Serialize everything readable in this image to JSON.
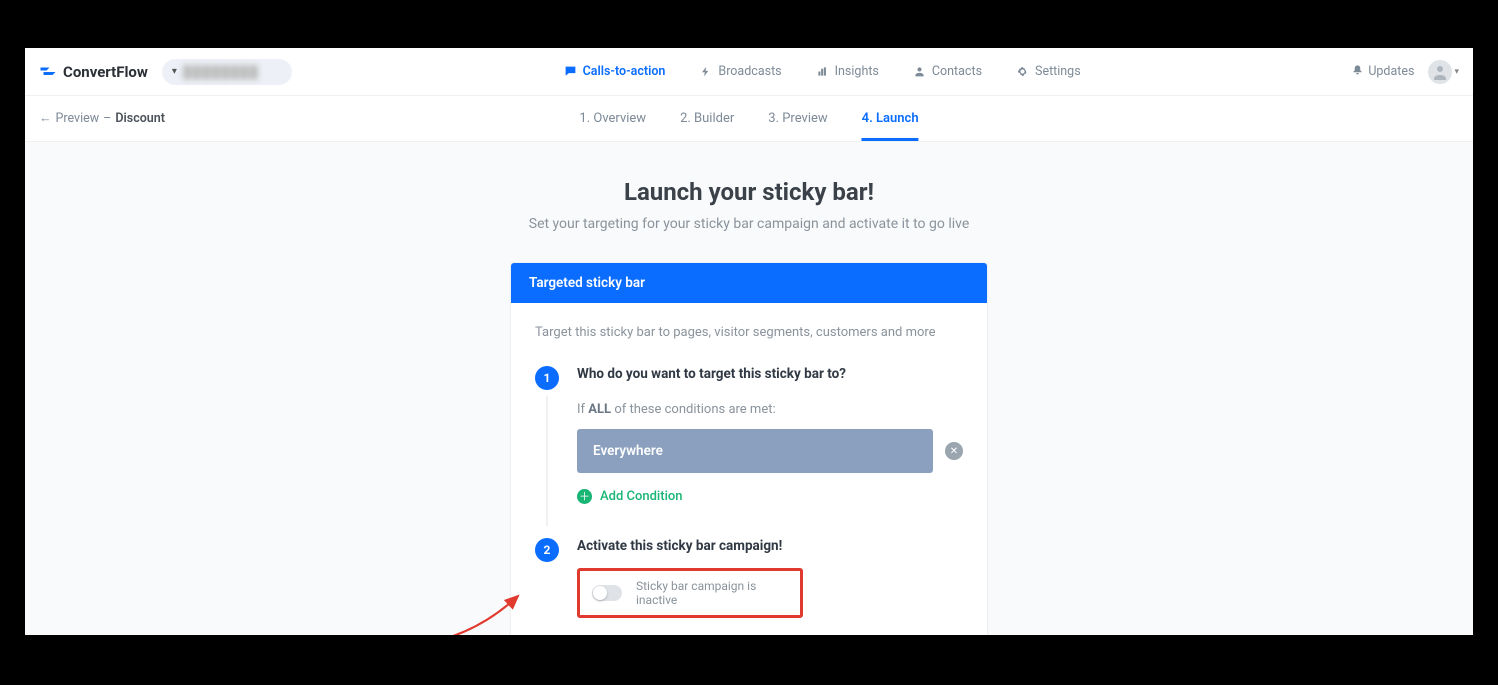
{
  "brand": {
    "name": "ConvertFlow"
  },
  "topnav": {
    "items": [
      {
        "label": "Calls-to-action"
      },
      {
        "label": "Broadcasts"
      },
      {
        "label": "Insights"
      },
      {
        "label": "Contacts"
      },
      {
        "label": "Settings"
      }
    ],
    "updates_label": "Updates"
  },
  "breadcrumb": {
    "back_arrow": "←",
    "preview": "Preview",
    "sep": "–",
    "name": "Discount"
  },
  "subtabs": [
    {
      "label": "1. Overview"
    },
    {
      "label": "2. Builder"
    },
    {
      "label": "3. Preview"
    },
    {
      "label": "4. Launch"
    }
  ],
  "hero": {
    "title": "Launch your sticky bar!",
    "subtitle": "Set your targeting for your sticky bar campaign and activate it to go live"
  },
  "card": {
    "header": "Targeted sticky bar",
    "description": "Target this sticky bar to pages, visitor segments, customers and more",
    "step1": {
      "num": "1",
      "title": "Who do you want to target this sticky bar to?",
      "cond_prefix": "If ",
      "cond_bold": "ALL",
      "cond_suffix": " of these conditions are met:",
      "condition_label": "Everywhere",
      "add_label": "Add Condition"
    },
    "step2": {
      "num": "2",
      "title": "Activate this sticky bar campaign!",
      "status_text": "Sticky bar campaign is inactive"
    }
  }
}
